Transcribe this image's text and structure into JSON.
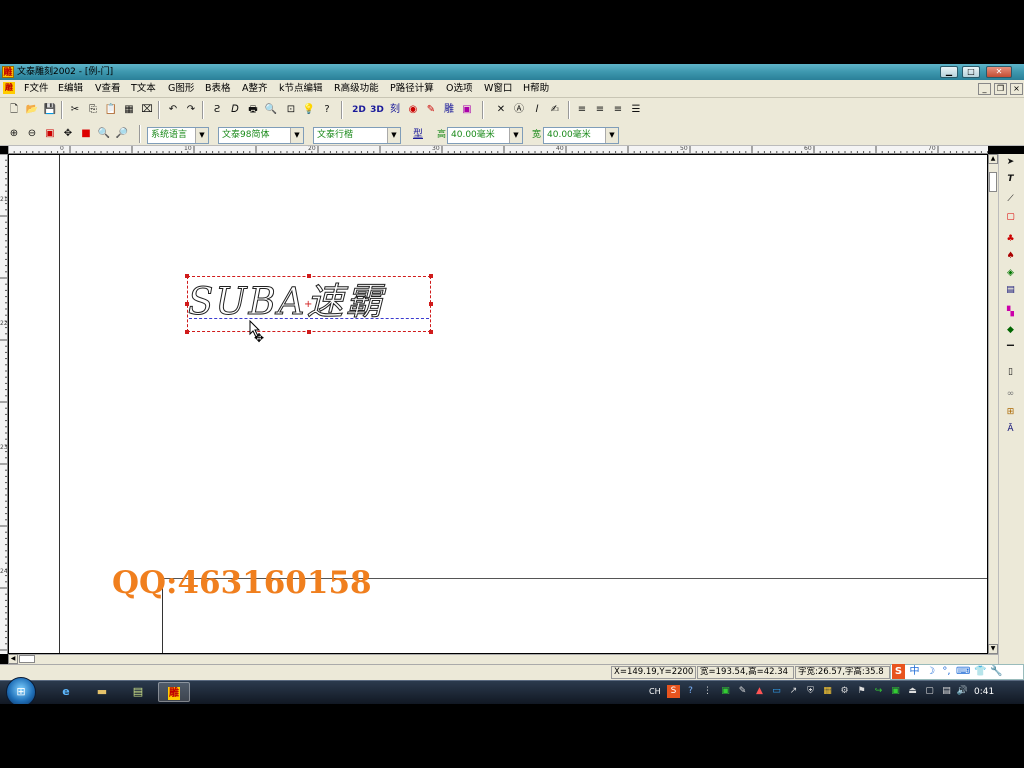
{
  "window": {
    "title": "文泰雕刻2002 - [例-门]",
    "app_icon_char": "雕",
    "controls": {
      "minimize": "▁",
      "maximize": "□",
      "close": "✕"
    },
    "mdi_controls": {
      "minimize": "_",
      "restore": "❐",
      "close": "×"
    }
  },
  "menubar": {
    "items": [
      "F文件",
      "E编辑",
      "V查看",
      "T文本",
      "G图形",
      "B表格",
      "A整齐",
      "k节点编辑",
      "R高级功能",
      "P路径计算",
      "O选项",
      "W窗口",
      "H帮助"
    ]
  },
  "toolbar1": {
    "text_buttons": {
      "2d": "2D",
      "3d": "3D"
    }
  },
  "toolbar2": {
    "font_language": "系统语言",
    "font_name": "文泰98简体",
    "font_style": "文泰行楷",
    "height_label": "高",
    "height_value": "40.00毫米",
    "width_label": "宽",
    "width_value": "40.00毫米",
    "type_button": "型"
  },
  "ruler": {
    "h_numbers": [
      "0",
      "10",
      "20",
      "30",
      "40",
      "50",
      "60",
      "70"
    ],
    "v_numbers": [
      "21",
      "22",
      "23",
      "24",
      "25"
    ]
  },
  "canvas": {
    "art_text": "SUBA速霸",
    "watermark": "QQ:463160158"
  },
  "statusbar": {
    "coords": "X=149.19,Y=2200",
    "size": "宽=193.54,高=42.34",
    "char_size": "字宽:26.57,字高:35.8"
  },
  "ime": {
    "items": [
      "S",
      "中",
      "☽",
      "°,",
      "⌨",
      "👕",
      "🔧"
    ]
  },
  "taskbar": {
    "lang": "CH",
    "clock": "0:41",
    "apps": [
      "ie-icon",
      "explorer-icon",
      "notepad-icon",
      "engrave-app-icon"
    ],
    "engrave_char": "雕"
  }
}
